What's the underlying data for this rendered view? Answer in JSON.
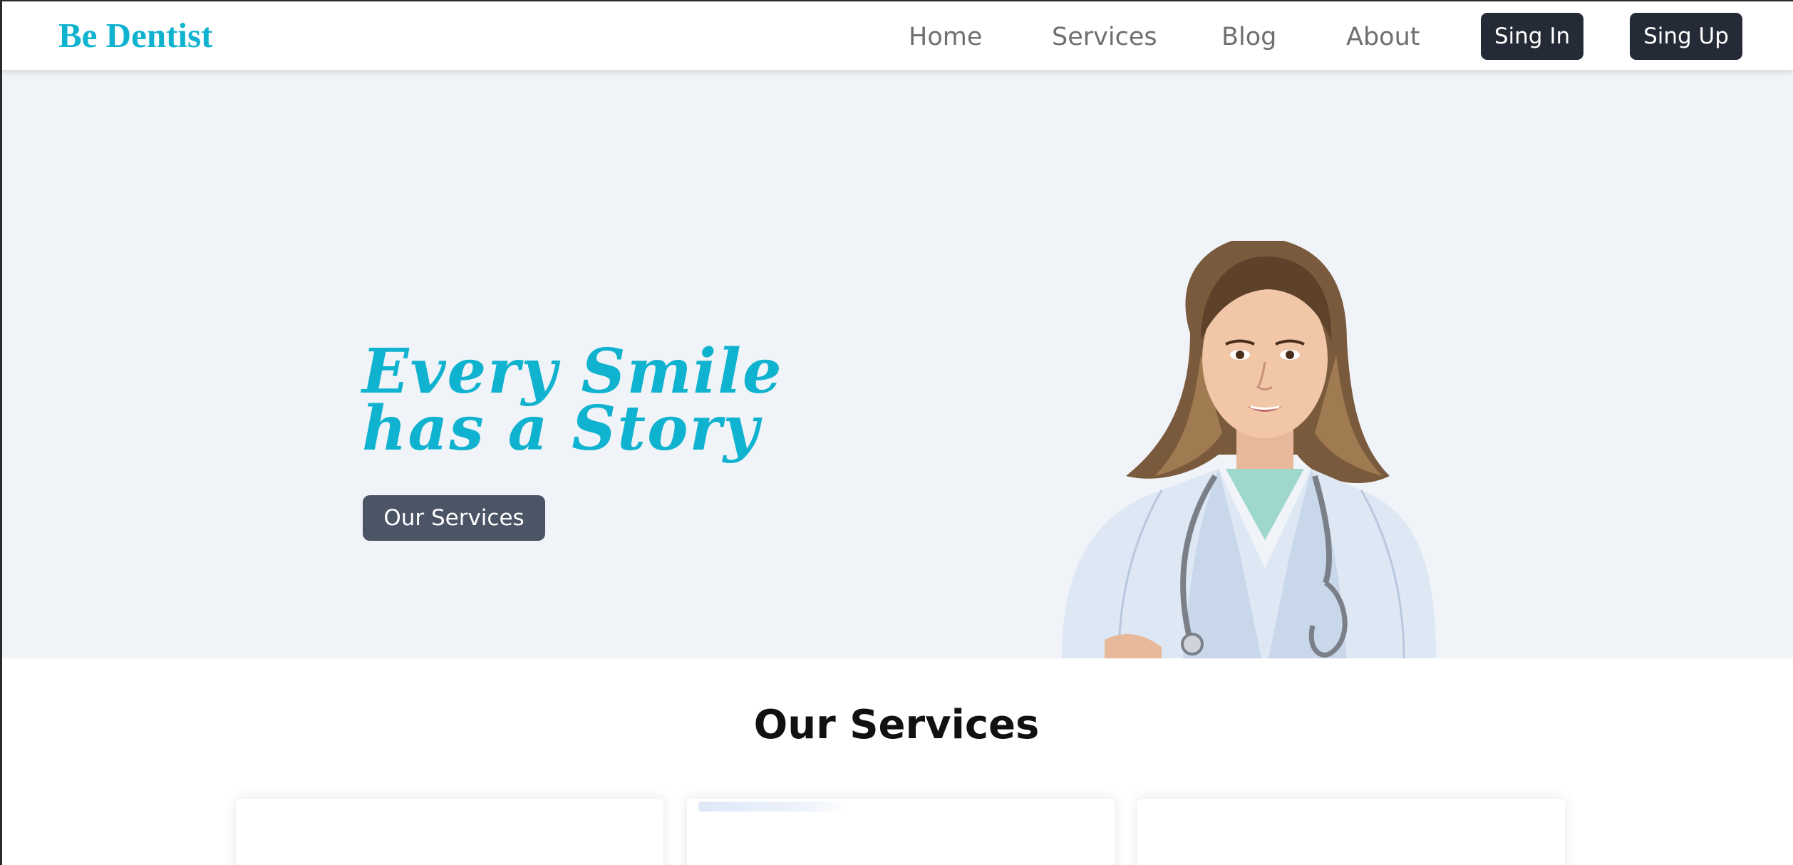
{
  "brand": {
    "name": "Be Dentist"
  },
  "nav": {
    "items": [
      {
        "label": "Home"
      },
      {
        "label": "Services"
      },
      {
        "label": "Blog"
      },
      {
        "label": "About"
      }
    ],
    "sign_in_label": "Sing In",
    "sign_up_label": "Sing Up"
  },
  "hero": {
    "title_line1": "Every Smile",
    "title_line2": "has a Story",
    "cta_label": "Our Services",
    "image": "dentist-portrait"
  },
  "services": {
    "heading": "Our Services",
    "card_count": 3
  },
  "colors": {
    "brand_accent": "#0fb3cf",
    "nav_text": "#6f6f6f",
    "dark_button": "#252a37",
    "hero_button": "#4b5566",
    "hero_background": "#f0f3f8"
  }
}
